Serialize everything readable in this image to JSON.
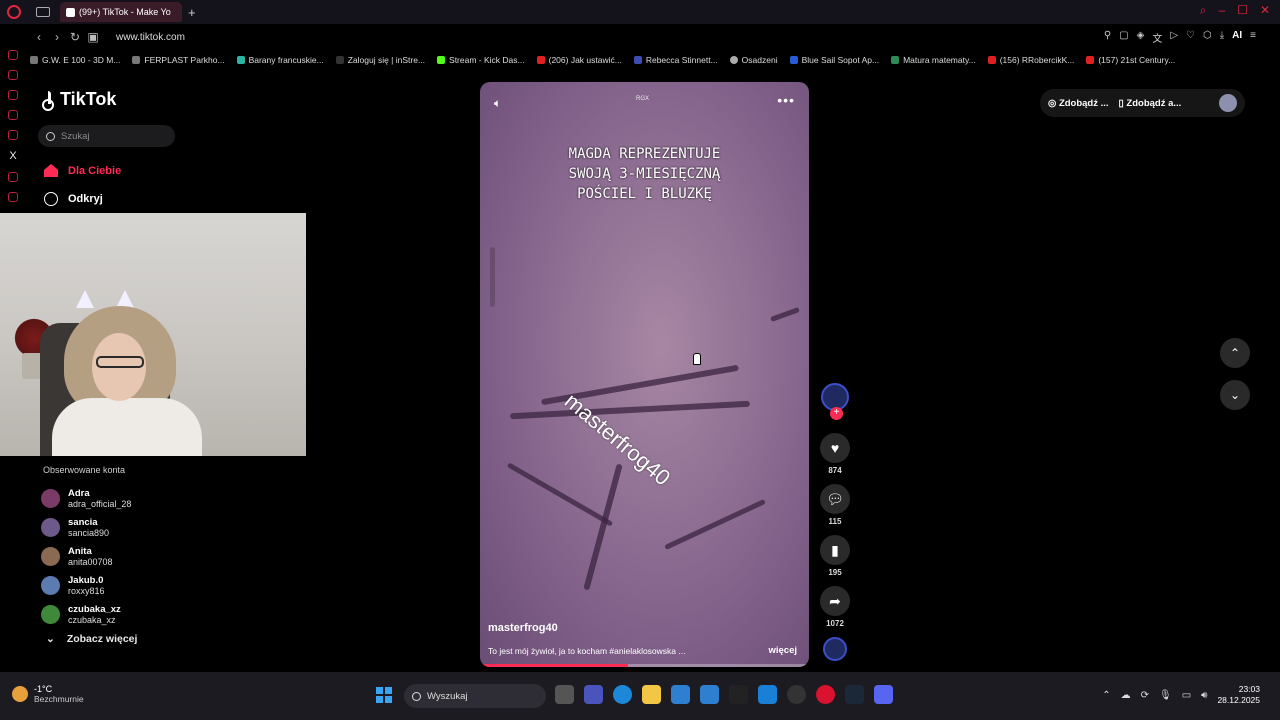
{
  "browser": {
    "tab_title": "(99+) TikTok - Make Yo",
    "url": "www.tiktok.com",
    "bookmarks": [
      "G.W. E 100 - 3D M...",
      "FERPLAST Parkho...",
      "Barany francuskie...",
      "Zaloguj się | inStre...",
      "Stream - Kick Das...",
      "(206) Jak ustawić...",
      "Rebecca Stinnett...",
      "Osadzeni",
      "Blue Sail Sopot Ap...",
      "Matura matematy...",
      "(156) RRobercikK...",
      "(157) 21st Century..."
    ],
    "ai_label": "AI"
  },
  "sidebar": {
    "logo_text": "TikTok",
    "search_placeholder": "Szukaj",
    "nav": {
      "for_you": "Dla Ciebie",
      "explore": "Odkryj"
    },
    "following_title": "Obserwowane konta",
    "following": [
      {
        "name": "Adra",
        "handle": "adra_official_28",
        "color": "#7a3b66"
      },
      {
        "name": "sancia",
        "handle": "sancia890",
        "color": "#6b5a8a"
      },
      {
        "name": "Anita",
        "handle": "anita00708",
        "color": "#8a6a52"
      },
      {
        "name": "Jakub.0",
        "handle": "roxxy816",
        "color": "#5c7bb0"
      },
      {
        "name": "czubaka_xz",
        "handle": "czubaka_xz",
        "color": "#3f8a3a"
      }
    ],
    "see_more": "Zobacz więcej"
  },
  "video": {
    "caption": "MAGDA REPREZENTUJE\nSWOJĄ 3-MIESIĘCZNĄ\nPOŚCIEL I BLUZKĘ",
    "watermark": "masterfrog40",
    "badge": "RGX",
    "author": "masterfrog40",
    "description": "To jest mój żywioł, ja to kocham #anielaklosowska ...",
    "more_label": "więcej",
    "progress": 0.45
  },
  "actions": {
    "likes": "874",
    "comments": "115",
    "saves": "195",
    "shares": "1072"
  },
  "top_right": {
    "coins_label": "Zdobądź ...",
    "app_label": "Zdobądź a..."
  },
  "taskbar": {
    "temperature": "-1°C",
    "weather_desc": "Bezchmurnie",
    "search_placeholder": "Wyszukaj",
    "time": "23:03",
    "date": "28.12.2025"
  }
}
